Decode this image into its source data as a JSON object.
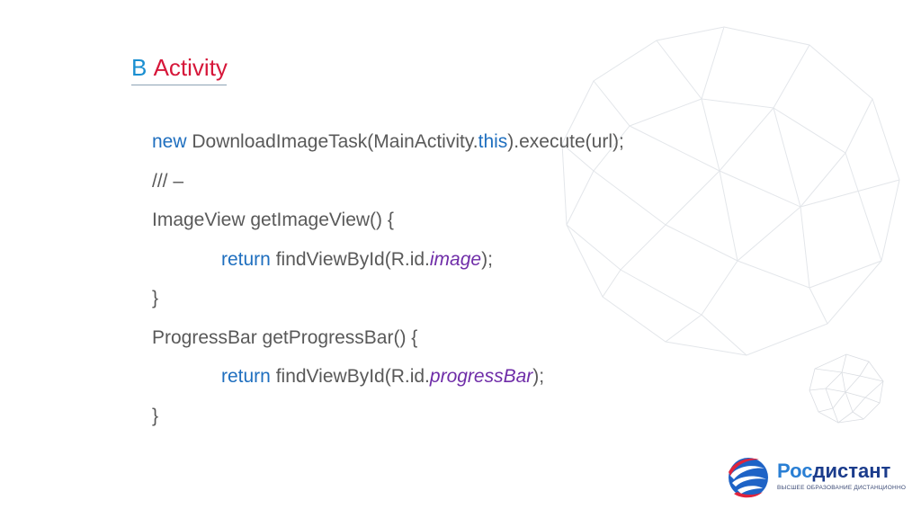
{
  "slide": {
    "title_word1": "В",
    "title_word2": "Activity"
  },
  "code": {
    "l1_kw": "new",
    "l1_a": " DownloadImageTask(MainActivity.",
    "l1_kw2": "this",
    "l1_b": ").execute(url);",
    "l2": "/// –",
    "l3": "ImageView getImageView() {",
    "l4_kw": "return",
    "l4_a": " findViewById(R.id.",
    "l4_id": "image",
    "l4_b": ");",
    "l5": "}",
    "l6": "ProgressBar getProgressBar() {",
    "l7_kw": "return",
    "l7_a": " findViewById(R.id.",
    "l7_id": "progressBar",
    "l7_b": ");",
    "l8": "}"
  },
  "logo": {
    "name_part1": "Рос",
    "name_part2": "дистант",
    "tagline": "ВЫСШЕЕ ОБРАЗОВАНИЕ ДИСТАНЦИОННО"
  },
  "colors": {
    "title_blue": "#1a8fd1",
    "title_red": "#d6173a",
    "keyword": "#1f6fbf",
    "identifier": "#6f2da8",
    "code_text": "#595959"
  },
  "icons": [
    "geodesic-sphere-graphic",
    "rosdistant-logo-icon"
  ]
}
